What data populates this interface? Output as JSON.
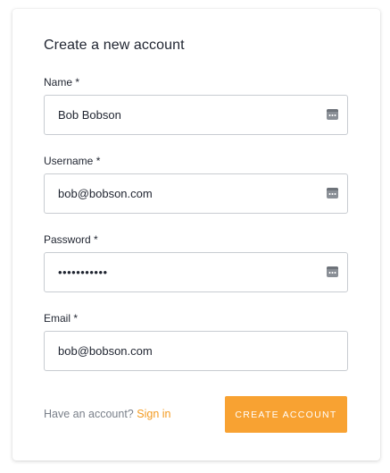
{
  "form": {
    "title": "Create a new account",
    "fields": [
      {
        "label": "Name *",
        "value": "Bob Bobson",
        "type": "text",
        "autofill_icon": "contact-card-icon"
      },
      {
        "label": "Username *",
        "value": "bob@bobson.com",
        "type": "text",
        "autofill_icon": "contact-card-icon"
      },
      {
        "label": "Password *",
        "value": "•••••••••••",
        "type": "password",
        "autofill_icon": "contact-card-icon"
      },
      {
        "label": "Email *",
        "value": "bob@bobson.com",
        "type": "email"
      }
    ],
    "footer": {
      "prompt": "Have an account?",
      "signin_label": "Sign in",
      "submit_label": "CREATE ACCOUNT"
    }
  },
  "colors": {
    "accent": "#f8a232",
    "link": "#f39a1f",
    "text": "#1f2430",
    "muted_text": "#7a808a",
    "input_border": "#c8ccd1"
  }
}
